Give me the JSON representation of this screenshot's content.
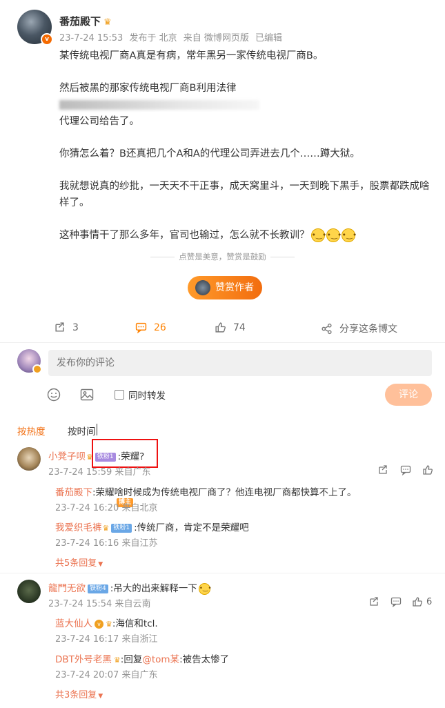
{
  "post": {
    "author": "番茄殿下",
    "timestamp": "23-7-24 15:53",
    "location": "发布于 北京",
    "source": "来自 微博网页版",
    "edited": "已编辑",
    "paragraphs": [
      "某传统电视厂商A真是有病，常年黑另一家传统电视厂商B。",
      "然后被黑的那家传统电视厂商B利用法律",
      "代理公司给告了。",
      "你猜怎么着？B还真把几个A和A的代理公司弄进去几个……蹲大狱。",
      "我就想说真的纱批，一天天不干正事，成天窝里斗，一天到晚下黑手，股票都跌成啥样了。",
      "这种事情干了那么多年，官司也输过，怎么就不长教训？"
    ],
    "reward_tip": "点赞是美意，赞赏是鼓励",
    "reward_button": "赞赏作者",
    "reposts": "3",
    "comments": "26",
    "likes": "74",
    "share": "分享这条博文"
  },
  "composer": {
    "placeholder": "发布你的评论",
    "repost_label": "同时转发",
    "submit_label": "评论"
  },
  "sort": {
    "hot": "按热度",
    "time": "按时间"
  },
  "comments": [
    {
      "name": "小凳子呗",
      "rank": "铁粉1",
      "text": ":荣耀?",
      "meta": "23-7-24 15:59 来自广东",
      "replies": [
        {
          "name": "番茄殿下",
          "badge": "博主",
          "text": ":荣耀啥时候成为传统电视厂商了？他连电视厂商都快算不上了。",
          "meta": "23-7-24 16:20 来自北京"
        },
        {
          "name": "我爱织毛裤",
          "badge": "铁粉1",
          "text": ":传统厂商，肯定不是荣耀吧",
          "meta": "23-7-24 16:16 来自江苏"
        }
      ],
      "more": "共5条回复"
    },
    {
      "name": "龍門无欲",
      "rank": "铁粉4",
      "text": ":吊大的出来解释一下",
      "meta": "23-7-24 15:54 来自云南",
      "likes": "6",
      "replies": [
        {
          "name": "蓝大仙人",
          "text": ":海信和tcl.",
          "meta": "23-7-24 16:17 来自浙江"
        },
        {
          "name": "DBT外号老黑",
          "text_prefix": ":回复",
          "mention": "@tom某",
          "text_suffix": ":被告太惨了",
          "meta": "23-7-24 20:07 来自广东"
        }
      ],
      "more": "共3条回复"
    }
  ],
  "colors": {
    "accent": "#ff8200",
    "name": "#eb7350",
    "meta": "#939393"
  }
}
